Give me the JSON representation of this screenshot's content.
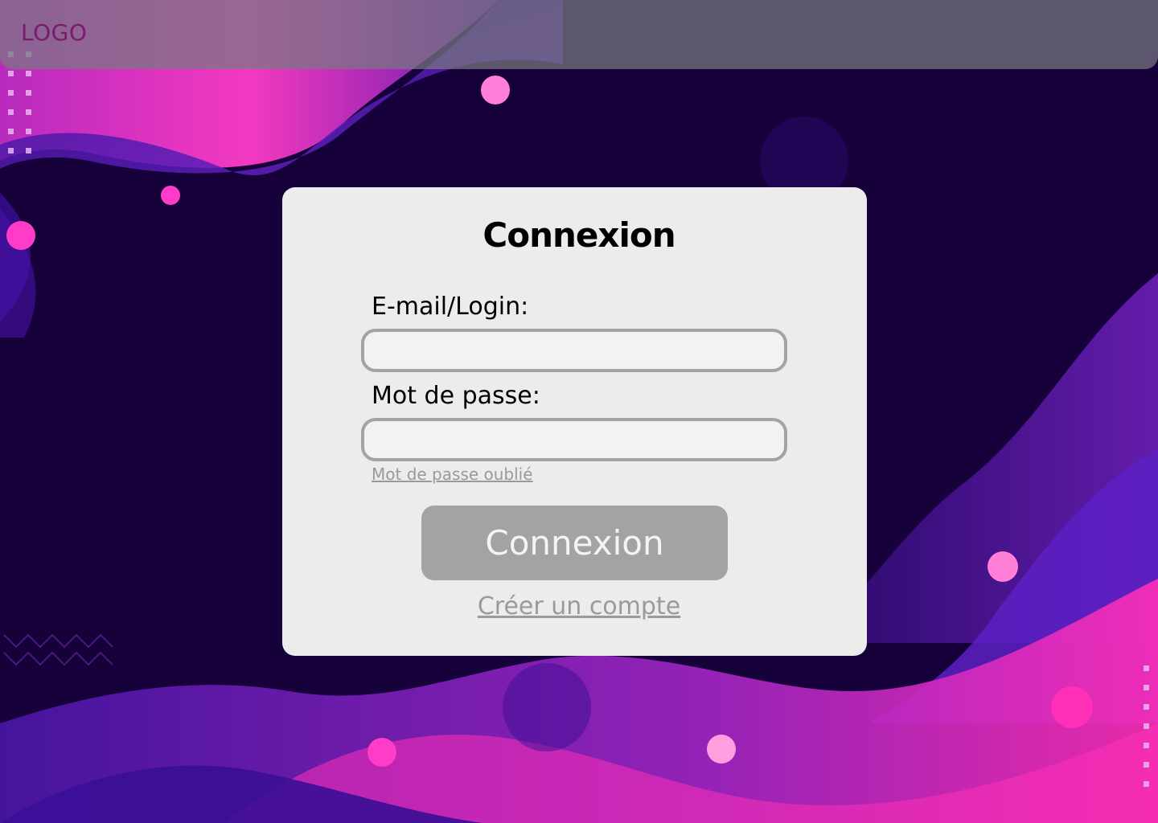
{
  "header": {
    "logo_text": "LOGO"
  },
  "login": {
    "title": "Connexion",
    "email_label": "E-mail/Login:",
    "email_value": "",
    "password_label": "Mot de passe:",
    "password_value": "",
    "forgot_link": "Mot de passe oublié",
    "submit_label": "Connexion",
    "create_account_link": "Créer un compte"
  },
  "colors": {
    "background": "#16013a",
    "accent_pink": "#ff2fb8",
    "accent_purple": "#5a1ab8",
    "card": "#ececec",
    "button": "#a3a3a3"
  }
}
